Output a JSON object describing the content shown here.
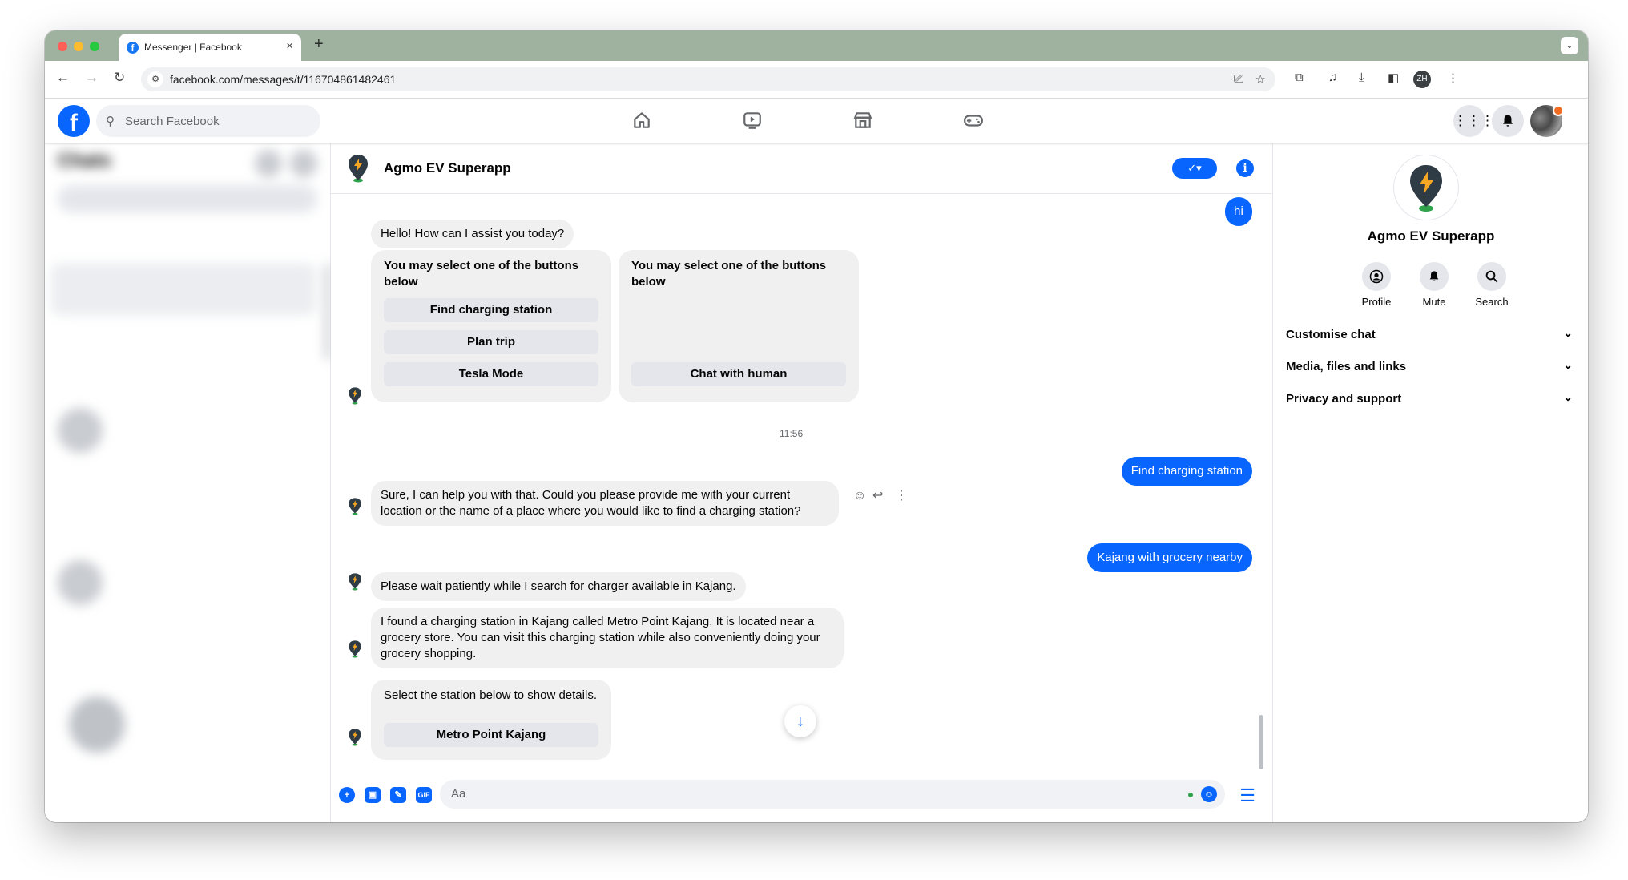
{
  "browser": {
    "tab_title": "Messenger | Facebook",
    "tab_close": "×",
    "new_tab": "+",
    "url": "facebook.com/messages/t/116704861482461",
    "profile_initials": "ZH"
  },
  "fb": {
    "logo_letter": "f",
    "search_placeholder": "Search Facebook",
    "nav_tabs": [
      "home-icon",
      "video-icon",
      "marketplace-icon",
      "gaming-icon"
    ]
  },
  "chats": {
    "title": "Chats"
  },
  "conversation": {
    "name": "Agmo EV Superapp",
    "verified_label": "✓▾",
    "info_label": "i",
    "messages": {
      "hi": "hi",
      "greeting": "Hello! How can I assist you today?",
      "card1": {
        "text": "You may select one of the buttons below",
        "buttons": [
          "Find charging station",
          "Plan trip",
          "Tesla Mode"
        ]
      },
      "card2": {
        "text": "You may select one of the buttons below",
        "buttons": [
          "Chat with human"
        ]
      },
      "timestamp": "11:56",
      "find_station": "Find charging station",
      "help_reply": "Sure, I can help you with that. Could you please provide me with your current location or the name of a place where you would like to find a charging station?",
      "kajang": "Kajang with grocery nearby",
      "wait": "Please wait patiently while I search for charger available in Kajang.",
      "found": "I found a charging station in Kajang called Metro Point Kajang. It is located near a grocery store. You can visit this charging station while also conveniently doing your grocery shopping.",
      "card3": {
        "text": "Select the station below to show details.",
        "buttons": [
          "Metro Point Kajang"
        ]
      }
    },
    "composer_placeholder": "Aa"
  },
  "info_panel": {
    "name": "Agmo EV Superapp",
    "actions": [
      {
        "label": "Profile",
        "icon": "profile-icon"
      },
      {
        "label": "Mute",
        "icon": "bell-icon"
      },
      {
        "label": "Search",
        "icon": "search-icon"
      }
    ],
    "sections": [
      "Customise chat",
      "Media, files and links",
      "Privacy and support"
    ]
  },
  "colors": {
    "accent": "#0866ff",
    "tab_strip": "#9fb19f",
    "bubble_in": "#f0f0f0"
  }
}
